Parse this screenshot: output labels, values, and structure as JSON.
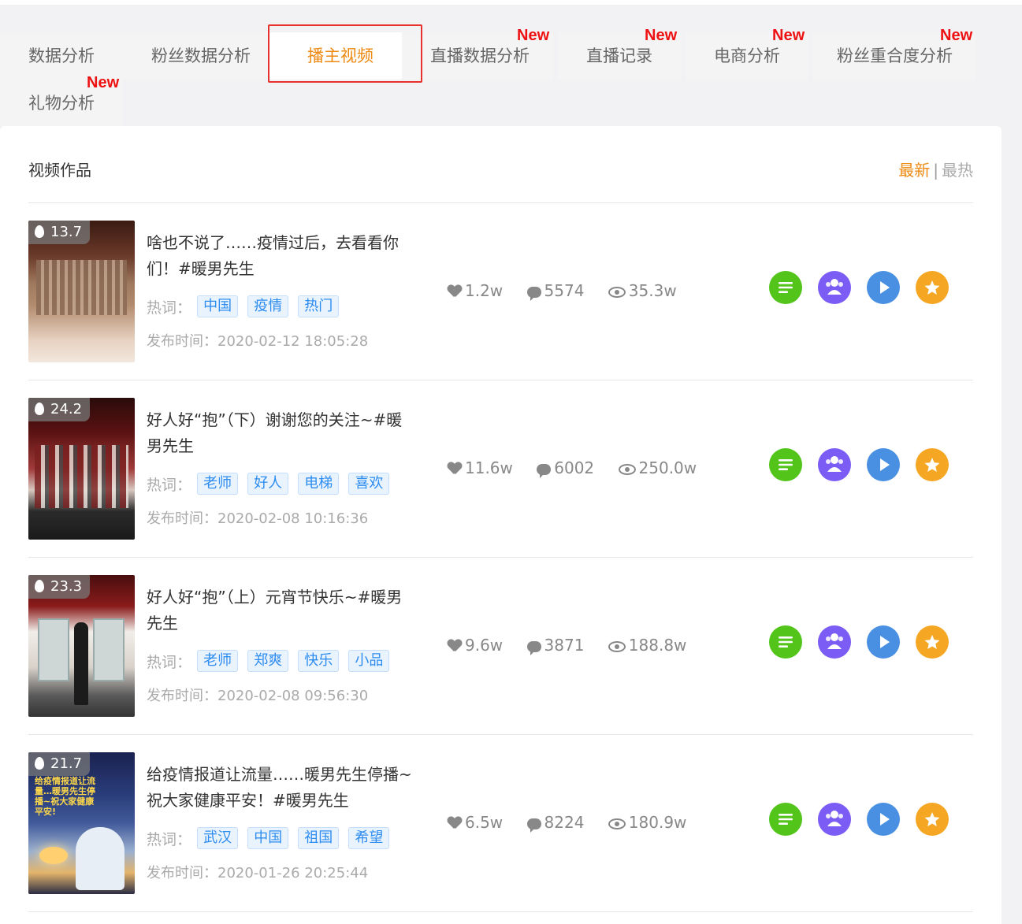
{
  "tabs": [
    {
      "label": "数据分析",
      "badge": ""
    },
    {
      "label": "粉丝数据分析",
      "badge": ""
    },
    {
      "label": "播主视频",
      "badge": "",
      "active": true
    },
    {
      "label": "直播数据分析",
      "badge": "New"
    },
    {
      "label": "直播记录",
      "badge": "New"
    },
    {
      "label": "电商分析",
      "badge": "New"
    },
    {
      "label": "粉丝重合度分析",
      "badge": "New"
    },
    {
      "label": "礼物分析",
      "badge": "New"
    }
  ],
  "panel": {
    "title": "视频作品",
    "sort": {
      "latest": "最新",
      "separator": "|",
      "hot": "最热",
      "selected": "最新"
    }
  },
  "labels": {
    "hot_words": "热词：",
    "publish_prefix": "发布时间："
  },
  "colors": {
    "accent": "#ee8a12",
    "tag_blue": "#2d8cf0",
    "new_red": "#ee1111",
    "highlight_border": "#e8312d"
  },
  "icons": {
    "stats": [
      "like-icon",
      "comment-icon",
      "view-icon"
    ],
    "actions": [
      "detail-list-icon",
      "fans-icon",
      "play-icon",
      "star-icon"
    ]
  },
  "videos": [
    {
      "heat": "13.7",
      "title": "啥也不说了……疫情过后，去看看你们！#暖男先生",
      "tags": [
        "中国",
        "疫情",
        "热门"
      ],
      "publish_time": "发布时间：2020-02-12 18:05:28",
      "likes": "1.2w",
      "comments": "5574",
      "views": "35.3w"
    },
    {
      "heat": "24.2",
      "title": "好人好“抱”（下）谢谢您的关注~#暖男先生",
      "tags": [
        "老师",
        "好人",
        "电梯",
        "喜欢"
      ],
      "publish_time": "发布时间：2020-02-08 10:16:36",
      "likes": "11.6w",
      "comments": "6002",
      "views": "250.0w"
    },
    {
      "heat": "23.3",
      "title": "好人好“抱”（上）元宵节快乐~#暖男先生",
      "tags": [
        "老师",
        "郑爽",
        "快乐",
        "小品"
      ],
      "publish_time": "发布时间：2020-02-08 09:56:30",
      "likes": "9.6w",
      "comments": "3871",
      "views": "188.8w"
    },
    {
      "heat": "21.7",
      "title": "给疫情报道让流量……暖男先生停播~祝大家健康平安！#暖男先生",
      "tags": [
        "武汉",
        "中国",
        "祖国",
        "希望"
      ],
      "publish_time": "发布时间：2020-01-26 20:25:44",
      "likes": "6.5w",
      "comments": "8224",
      "views": "180.9w",
      "thumb_text": "给疫情报道让流量…暖男先生停播~祝大家健康平安!"
    }
  ]
}
